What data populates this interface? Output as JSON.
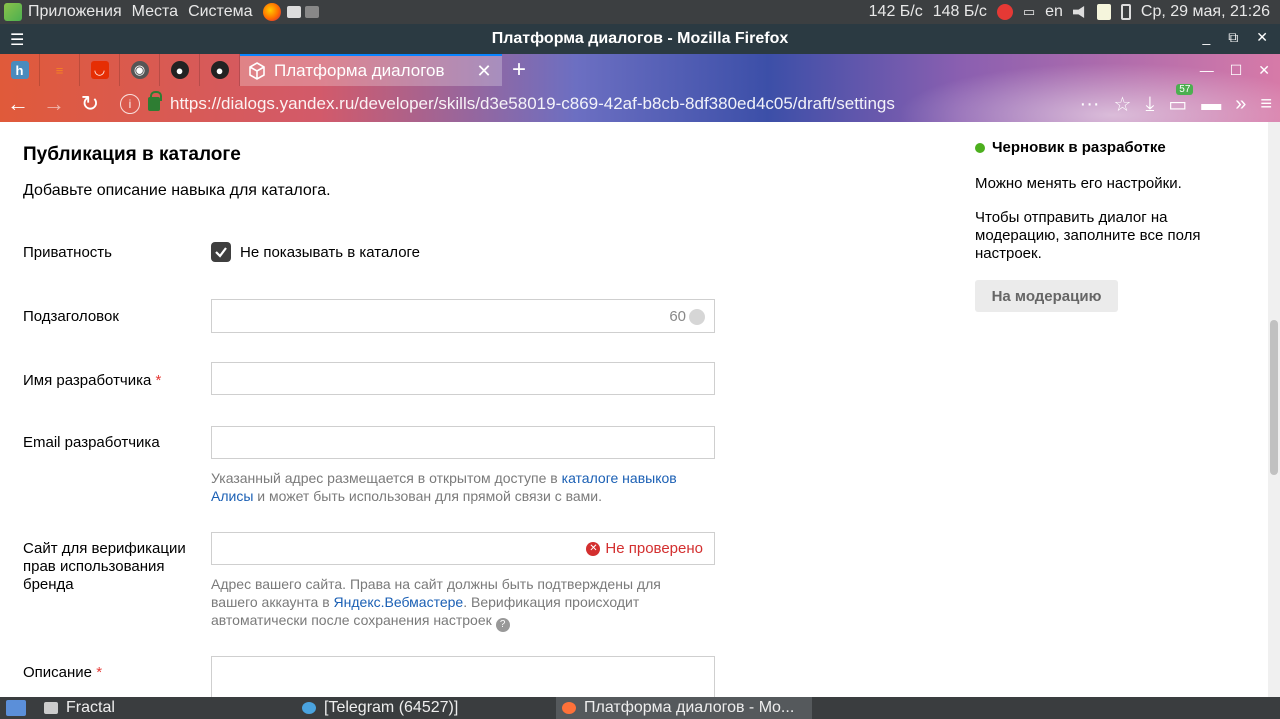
{
  "system_panel": {
    "menu": [
      "Приложения",
      "Места",
      "Система"
    ],
    "net_down": "142 Б/с",
    "net_up": "148 Б/с",
    "vk_badge": "27",
    "keyboard_layout": "en",
    "datetime": "Ср, 29 мая, 21:26"
  },
  "window": {
    "title": "Платформа диалогов - Mozilla Firefox"
  },
  "browser": {
    "active_tab_title": "Платформа диалогов",
    "url": "https://dialogs.yandex.ru/developer/skills/d3e58019-c869-42af-b8cb-8df380ed4c05/draft/settings",
    "ext_badge": "57",
    "pinned_tabs": [
      {
        "name": "habr-tab",
        "letter": "h",
        "color": "#4a8bbd"
      },
      {
        "name": "stackoverflow-tab",
        "letter": "",
        "color": "#f48024"
      },
      {
        "name": "aliexpress-tab",
        "letter": "",
        "color": "#e62e04"
      },
      {
        "name": "chrome-tab",
        "letter": "",
        "color": "#5f6368"
      },
      {
        "name": "github-tab-1",
        "letter": "",
        "color": "#222"
      },
      {
        "name": "github-tab-2",
        "letter": "",
        "color": "#222"
      }
    ]
  },
  "form": {
    "section_title": "Публикация в каталоге",
    "section_desc": "Добавьте описание навыка для каталога.",
    "privacy": {
      "label": "Приватность",
      "checkbox_label": "Не показывать в каталоге",
      "checked": true
    },
    "subtitle": {
      "label": "Подзаголовок",
      "value": "",
      "counter": "60"
    },
    "developer_name": {
      "label": "Имя разработчика",
      "required_mark": "*",
      "value": ""
    },
    "developer_email": {
      "label": "Email разработчика",
      "value": "",
      "hint_before": "Указанный адрес размещается в открытом доступе в ",
      "hint_link": "каталоге навыков Алисы",
      "hint_after": " и может быть использован для прямой связи с вами."
    },
    "brand_site": {
      "label": "Сайт для верификации прав использования бренда",
      "value": "",
      "status": "Не проверено",
      "hint_before": "Адрес вашего сайта. Права на сайт должны быть подтверждены для вашего аккаунта в ",
      "hint_link": "Яндекс.Вебмастере",
      "hint_after": ". Верификация происходит автоматически после сохранения настроек",
      "help_mark": "?"
    },
    "description": {
      "label": "Описание",
      "required_mark": "*",
      "value": ""
    }
  },
  "sidebar": {
    "status": "Черновик в разработке",
    "status_color": "#4caf1e",
    "text1": "Можно менять его настройки.",
    "text2": "Чтобы отправить диалог на модерацию, заполните все поля настроек.",
    "moderation_button": "На модерацию"
  },
  "taskbar": {
    "items": [
      {
        "label": "Fractal"
      },
      {
        "label": "[Telegram (64527)]"
      },
      {
        "label": "Платформа диалогов - Mo..."
      }
    ]
  }
}
